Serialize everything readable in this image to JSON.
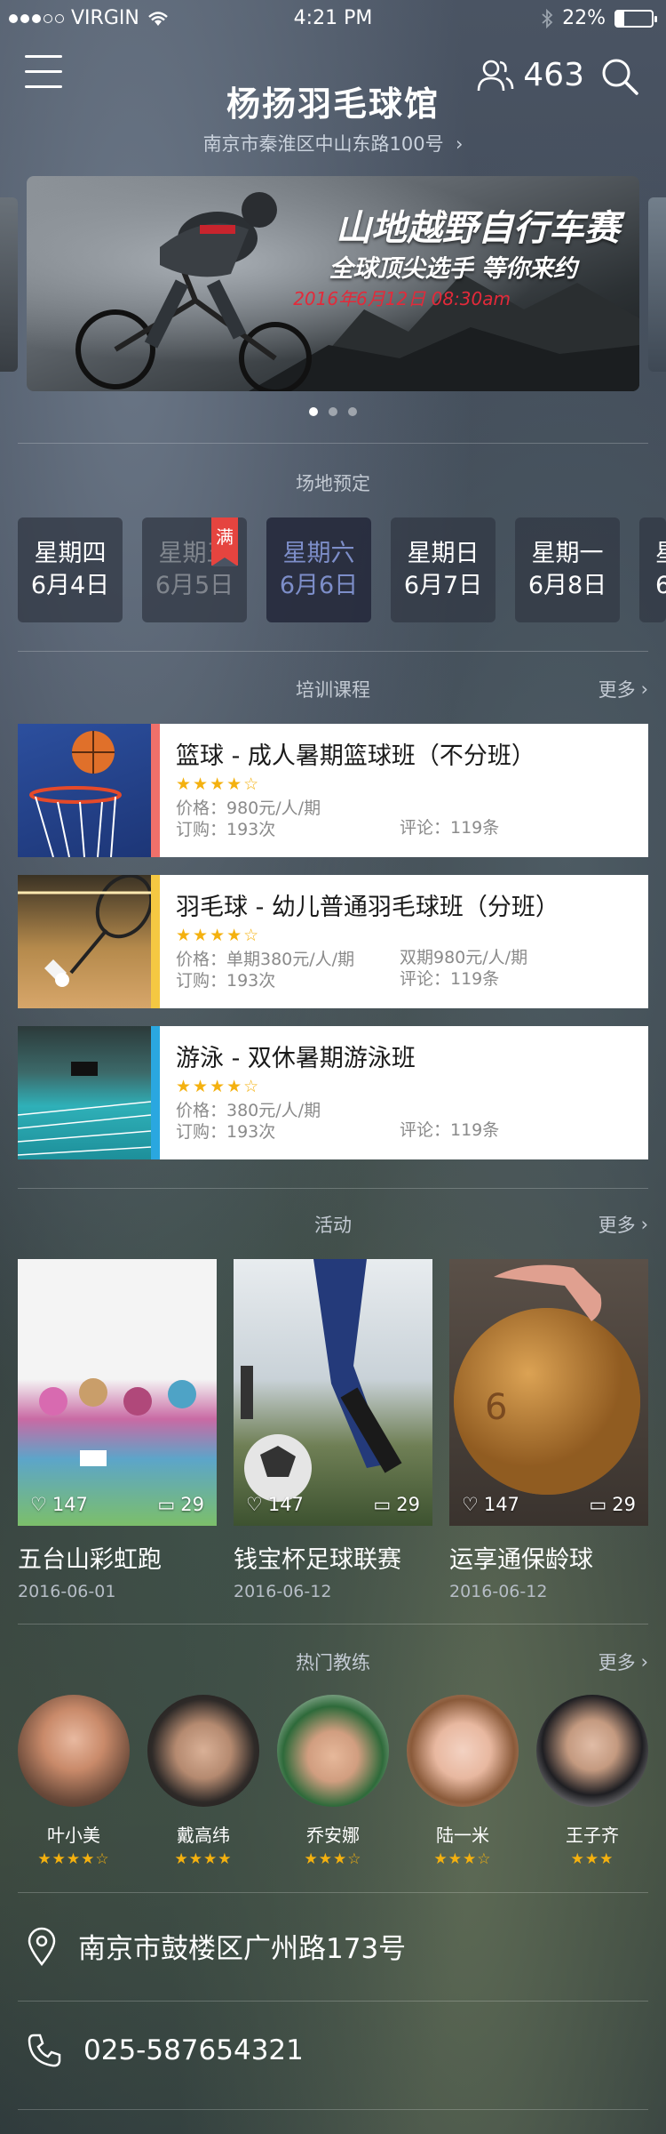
{
  "status_bar": {
    "carrier": "VIRGIN",
    "time": "4:21 PM",
    "battery": "22%"
  },
  "header": {
    "title": "杨扬羽毛球馆",
    "address": "南京市秦淮区中山东路100号",
    "user_count": "463"
  },
  "banner": {
    "title": "山地越野自行车赛",
    "subtitle": "全球顶尖选手  等你来约",
    "date": "2016年6月12日  08:30am"
  },
  "booking": {
    "section_title": "场地预定",
    "full_badge": "满",
    "days": [
      {
        "weekday": "星期四",
        "date": "6月4日",
        "state": "normal"
      },
      {
        "weekday": "星期五",
        "date": "6月5日",
        "state": "full"
      },
      {
        "weekday": "星期六",
        "date": "6月6日",
        "state": "selected"
      },
      {
        "weekday": "星期日",
        "date": "6月7日",
        "state": "normal"
      },
      {
        "weekday": "星期一",
        "date": "6月8日",
        "state": "normal"
      },
      {
        "weekday": "星",
        "date": "6",
        "state": "normal"
      }
    ]
  },
  "courses": {
    "section_title": "培训课程",
    "more": "更多",
    "items": [
      {
        "title": "篮球 - 成人暑期篮球班（不分班）",
        "stars": "★★★★☆",
        "price": "价格：980元/人/期",
        "price2": "",
        "orders": "订购：193次",
        "reviews": "评论：119条",
        "accent": "#f0706a"
      },
      {
        "title": "羽毛球 - 幼儿普通羽毛球班（分班）",
        "stars": "★★★★☆",
        "price": "价格：单期380元/人/期",
        "price2": "双期980元/人/期",
        "orders": "订购：193次",
        "reviews": "评论：119条",
        "accent": "#f5c842"
      },
      {
        "title": "游泳 - 双休暑期游泳班",
        "stars": "★★★★☆",
        "price": "价格：380元/人/期",
        "price2": "",
        "orders": "订购：193次",
        "reviews": "评论：119条",
        "accent": "#2aa7e0"
      }
    ]
  },
  "activities": {
    "section_title": "活动",
    "more": "更多",
    "items": [
      {
        "name": "五台山彩虹跑",
        "date": "2016-06-01",
        "likes": "147",
        "comments": "29"
      },
      {
        "name": "钱宝杯足球联赛",
        "date": "2016-06-12",
        "likes": "147",
        "comments": "29"
      },
      {
        "name": "运享通保龄球",
        "date": "2016-06-12",
        "likes": "147",
        "comments": "29"
      }
    ]
  },
  "coaches": {
    "section_title": "热门教练",
    "more": "更多",
    "items": [
      {
        "name": "叶小美",
        "stars": "★★★★☆"
      },
      {
        "name": "戴高纬",
        "stars": "★★★★"
      },
      {
        "name": "乔安娜",
        "stars": "★★★☆"
      },
      {
        "name": "陆一米",
        "stars": "★★★☆"
      },
      {
        "name": "王子齐",
        "stars": "★★★"
      }
    ]
  },
  "contact": {
    "address": "南京市鼓楼区广州路173号",
    "phone": "025-587654321"
  },
  "colors": {
    "accent_red": "#e5443f",
    "star": "#f4b10f",
    "selected_day": "#7d8ec9"
  }
}
